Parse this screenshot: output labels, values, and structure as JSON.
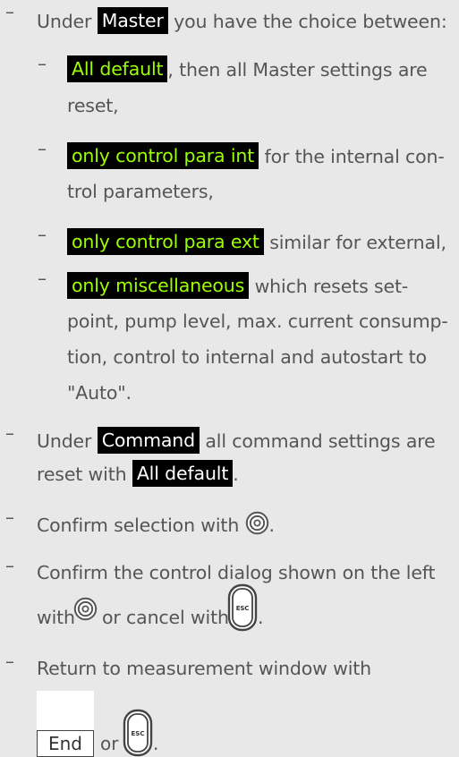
{
  "master": {
    "before": "Under",
    "key": "Master",
    "after": "you have the choice between:"
  },
  "options": [
    {
      "key": "All default",
      "after_line1": ", then all Master settings are",
      "line2": "reset,"
    },
    {
      "key": "only control para int",
      "after_line1": "for the internal con-",
      "line2": "trol parameters,"
    },
    {
      "key": "only control para ext",
      "after_line1": "similar for external,"
    },
    {
      "key": "only miscellaneous",
      "after_line1": "which resets  set-",
      "line2": "point, pump level, max. current consump-",
      "line3": "tion, control to internal and autostart to",
      "line4": "\"Auto\"."
    }
  ],
  "command": {
    "before": "Under",
    "key": "Command",
    "after": "all command settings are",
    "line2_before": "reset with",
    "line2_key": "All default",
    "line2_after": "."
  },
  "confirm_selection": {
    "text": "Confirm selection with",
    "after": "."
  },
  "confirm_dialog": {
    "line1": "Confirm the control dialog shown on the left",
    "with": "with",
    "or_cancel": "or cancel with",
    "after": "."
  },
  "return": {
    "line1": "Return to measurement window with",
    "key": "End",
    "or": "or",
    "after": "."
  },
  "dash": "–",
  "esc_label": "ESC",
  "colors": {
    "background": "#e8e8e8",
    "text": "#555555",
    "highlight_bg": "#000000",
    "highlight_text": "#9CFF00",
    "highlight_text_alt": "#ffffff"
  },
  "icons": {
    "enter": "enter-button-icon",
    "esc": "esc-button-icon"
  }
}
